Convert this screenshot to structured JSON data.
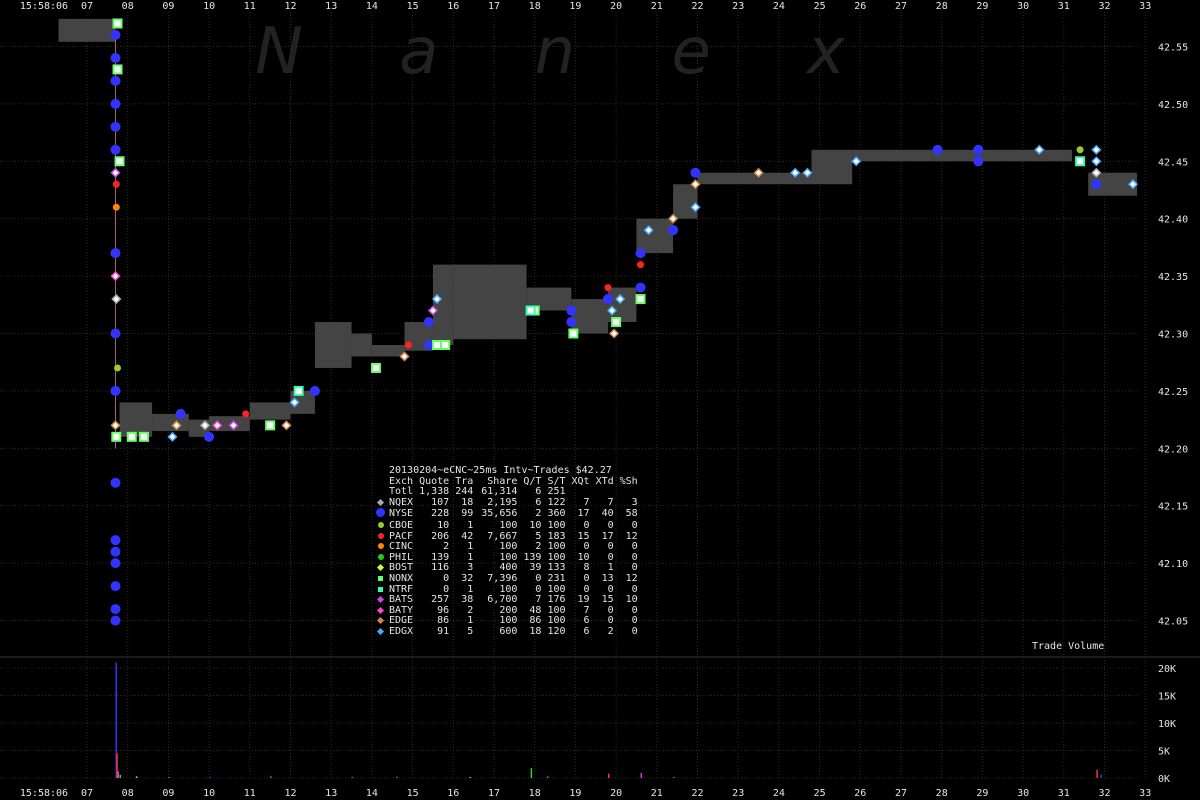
{
  "chart_data": [
    {
      "type": "scatter",
      "title": "20130204~eCNC~25ms Intv~Trades $42.27",
      "start_time_label": "15:58:06",
      "x_tick_labels": [
        "07",
        "08",
        "09",
        "10",
        "11",
        "12",
        "13",
        "14",
        "15",
        "16",
        "17",
        "18",
        "19",
        "20",
        "21",
        "22",
        "23",
        "24",
        "25",
        "26",
        "27",
        "28",
        "29",
        "30",
        "31",
        "32",
        "33"
      ],
      "xlim": [
        6.5,
        33.4
      ],
      "ylim": [
        42.02,
        42.58
      ],
      "y_tick_labels": [
        "42.55",
        "42.50",
        "42.45",
        "42.40",
        "42.35",
        "42.30",
        "42.25",
        "42.20",
        "42.15",
        "42.10",
        "42.05"
      ],
      "y_ticks": [
        42.55,
        42.5,
        42.45,
        42.4,
        42.35,
        42.3,
        42.25,
        42.2,
        42.15,
        42.1,
        42.05
      ],
      "quote_spread": [
        [
          6.3,
          7.7,
          42.554,
          42.574
        ],
        [
          7.8,
          8.6,
          42.21,
          42.24
        ],
        [
          8.6,
          9.5,
          42.215,
          42.23
        ],
        [
          9.5,
          10.0,
          42.21,
          42.225
        ],
        [
          10.0,
          11.0,
          42.215,
          42.228
        ],
        [
          11.0,
          12.0,
          42.225,
          42.24
        ],
        [
          12.0,
          12.6,
          42.23,
          42.25
        ],
        [
          12.6,
          13.5,
          42.27,
          42.31
        ],
        [
          13.5,
          14.0,
          42.28,
          42.3
        ],
        [
          14.0,
          14.8,
          42.28,
          42.29
        ],
        [
          14.8,
          15.5,
          42.285,
          42.31
        ],
        [
          15.5,
          16.0,
          42.29,
          42.36
        ],
        [
          16.0,
          17.8,
          42.295,
          42.36
        ],
        [
          17.8,
          18.9,
          42.32,
          42.34
        ],
        [
          18.9,
          19.8,
          42.3,
          42.33
        ],
        [
          19.8,
          20.5,
          42.31,
          42.34
        ],
        [
          20.5,
          21.4,
          42.37,
          42.4
        ],
        [
          21.4,
          22.0,
          42.4,
          42.43
        ],
        [
          22.0,
          24.8,
          42.43,
          42.44
        ],
        [
          24.8,
          25.8,
          42.43,
          42.46
        ],
        [
          25.8,
          31.2,
          42.45,
          42.46
        ],
        [
          31.6,
          32.8,
          42.42,
          42.44
        ]
      ],
      "trades": [
        {
          "x": 7.7,
          "y": 42.56,
          "ex": "NYSE"
        },
        {
          "x": 7.7,
          "y": 42.54,
          "ex": "NYSE"
        },
        {
          "x": 7.7,
          "y": 42.52,
          "ex": "NYSE"
        },
        {
          "x": 7.7,
          "y": 42.5,
          "ex": "NYSE"
        },
        {
          "x": 7.7,
          "y": 42.48,
          "ex": "NYSE"
        },
        {
          "x": 7.7,
          "y": 42.46,
          "ex": "NYSE"
        },
        {
          "x": 7.7,
          "y": 42.44,
          "ex": "BATS"
        },
        {
          "x": 7.72,
          "y": 42.43,
          "ex": "PACF"
        },
        {
          "x": 7.72,
          "y": 42.41,
          "ex": "CINC"
        },
        {
          "x": 7.7,
          "y": 42.37,
          "ex": "NYSE"
        },
        {
          "x": 7.7,
          "y": 42.35,
          "ex": "BATY"
        },
        {
          "x": 7.72,
          "y": 42.33,
          "ex": "NQEX"
        },
        {
          "x": 7.7,
          "y": 42.3,
          "ex": "NYSE"
        },
        {
          "x": 7.75,
          "y": 42.27,
          "ex": "CBOE"
        },
        {
          "x": 7.7,
          "y": 42.25,
          "ex": "NYSE"
        },
        {
          "x": 7.7,
          "y": 42.22,
          "ex": "EDGE"
        },
        {
          "x": 7.72,
          "y": 42.21,
          "ex": "NONX"
        },
        {
          "x": 7.7,
          "y": 42.17,
          "ex": "NYSE"
        },
        {
          "x": 7.7,
          "y": 42.12,
          "ex": "NYSE"
        },
        {
          "x": 7.7,
          "y": 42.11,
          "ex": "NYSE"
        },
        {
          "x": 7.7,
          "y": 42.1,
          "ex": "NYSE"
        },
        {
          "x": 7.7,
          "y": 42.08,
          "ex": "NYSE"
        },
        {
          "x": 7.7,
          "y": 42.06,
          "ex": "NYSE"
        },
        {
          "x": 7.7,
          "y": 42.05,
          "ex": "NYSE"
        },
        {
          "x": 7.75,
          "y": 42.57,
          "ex": "NONX"
        },
        {
          "x": 7.75,
          "y": 42.53,
          "ex": "NONX"
        },
        {
          "x": 7.8,
          "y": 42.45,
          "ex": "NONX"
        },
        {
          "x": 8.1,
          "y": 42.21,
          "ex": "NONX"
        },
        {
          "x": 8.4,
          "y": 42.21,
          "ex": "NONX"
        },
        {
          "x": 9.1,
          "y": 42.21,
          "ex": "EDGX"
        },
        {
          "x": 9.2,
          "y": 42.22,
          "ex": "EDGE"
        },
        {
          "x": 9.3,
          "y": 42.23,
          "ex": "NYSE"
        },
        {
          "x": 9.9,
          "y": 42.22,
          "ex": "NQEX"
        },
        {
          "x": 10.0,
          "y": 42.21,
          "ex": "NYSE"
        },
        {
          "x": 10.2,
          "y": 42.22,
          "ex": "BATY"
        },
        {
          "x": 10.6,
          "y": 42.22,
          "ex": "BATS"
        },
        {
          "x": 10.9,
          "y": 42.23,
          "ex": "PACF"
        },
        {
          "x": 11.5,
          "y": 42.22,
          "ex": "NONX"
        },
        {
          "x": 11.9,
          "y": 42.22,
          "ex": "EDGE"
        },
        {
          "x": 12.1,
          "y": 42.24,
          "ex": "EDGX"
        },
        {
          "x": 12.2,
          "y": 42.25,
          "ex": "NTRF"
        },
        {
          "x": 12.6,
          "y": 42.25,
          "ex": "NYSE"
        },
        {
          "x": 14.1,
          "y": 42.27,
          "ex": "NONX"
        },
        {
          "x": 14.8,
          "y": 42.28,
          "ex": "EDGE"
        },
        {
          "x": 14.9,
          "y": 42.29,
          "ex": "PACF"
        },
        {
          "x": 15.4,
          "y": 42.29,
          "ex": "NYSE"
        },
        {
          "x": 15.6,
          "y": 42.29,
          "ex": "NONX"
        },
        {
          "x": 15.8,
          "y": 42.29,
          "ex": "NONX"
        },
        {
          "x": 15.4,
          "y": 42.31,
          "ex": "NYSE"
        },
        {
          "x": 15.5,
          "y": 42.32,
          "ex": "BATS"
        },
        {
          "x": 15.6,
          "y": 42.33,
          "ex": "EDGX"
        },
        {
          "x": 18.0,
          "y": 42.32,
          "ex": "NONX"
        },
        {
          "x": 17.9,
          "y": 42.32,
          "ex": "NTRF"
        },
        {
          "x": 18.9,
          "y": 42.32,
          "ex": "NYSE"
        },
        {
          "x": 18.9,
          "y": 42.31,
          "ex": "NYSE"
        },
        {
          "x": 18.95,
          "y": 42.3,
          "ex": "NONX"
        },
        {
          "x": 19.8,
          "y": 42.34,
          "ex": "PACF"
        },
        {
          "x": 19.8,
          "y": 42.33,
          "ex": "NYSE"
        },
        {
          "x": 19.9,
          "y": 42.32,
          "ex": "EDGX"
        },
        {
          "x": 19.95,
          "y": 42.3,
          "ex": "EDGE"
        },
        {
          "x": 20.0,
          "y": 42.31,
          "ex": "NONX"
        },
        {
          "x": 20.1,
          "y": 42.33,
          "ex": "EDGX"
        },
        {
          "x": 20.6,
          "y": 42.37,
          "ex": "NYSE"
        },
        {
          "x": 20.6,
          "y": 42.36,
          "ex": "PACF"
        },
        {
          "x": 20.6,
          "y": 42.34,
          "ex": "NYSE"
        },
        {
          "x": 20.6,
          "y": 42.33,
          "ex": "NONX"
        },
        {
          "x": 20.8,
          "y": 42.39,
          "ex": "EDGX"
        },
        {
          "x": 21.4,
          "y": 42.4,
          "ex": "EDGE"
        },
        {
          "x": 21.4,
          "y": 42.39,
          "ex": "NYSE"
        },
        {
          "x": 21.95,
          "y": 42.44,
          "ex": "NYSE"
        },
        {
          "x": 21.95,
          "y": 42.43,
          "ex": "EDGE"
        },
        {
          "x": 21.95,
          "y": 42.41,
          "ex": "EDGX"
        },
        {
          "x": 23.5,
          "y": 42.44,
          "ex": "EDGE"
        },
        {
          "x": 24.4,
          "y": 42.44,
          "ex": "EDGX"
        },
        {
          "x": 24.7,
          "y": 42.44,
          "ex": "EDGX"
        },
        {
          "x": 25.9,
          "y": 42.45,
          "ex": "EDGX"
        },
        {
          "x": 27.9,
          "y": 42.46,
          "ex": "NYSE"
        },
        {
          "x": 28.9,
          "y": 42.46,
          "ex": "NYSE"
        },
        {
          "x": 28.9,
          "y": 42.45,
          "ex": "NYSE"
        },
        {
          "x": 30.4,
          "y": 42.46,
          "ex": "EDGX"
        },
        {
          "x": 31.4,
          "y": 42.46,
          "ex": "CBOE"
        },
        {
          "x": 31.4,
          "y": 42.45,
          "ex": "NTRF"
        },
        {
          "x": 31.8,
          "y": 42.46,
          "ex": "EDGX"
        },
        {
          "x": 31.8,
          "y": 42.45,
          "ex": "EDGX"
        },
        {
          "x": 31.8,
          "y": 42.44,
          "ex": "NQEX"
        },
        {
          "x": 31.8,
          "y": 42.43,
          "ex": "NYSE"
        },
        {
          "x": 32.7,
          "y": 42.43,
          "ex": "EDGX"
        }
      ],
      "watermark_letters": [
        "N",
        "a",
        "n",
        "e",
        "x"
      ]
    },
    {
      "type": "bar",
      "title": "Trade Volume",
      "y_tick_labels": [
        "20K",
        "15K",
        "10K",
        "5K",
        "0K"
      ],
      "y_ticks": [
        20000,
        15000,
        10000,
        5000,
        0
      ],
      "ylim": [
        0,
        22000
      ],
      "bars": [
        {
          "x": 7.7,
          "v": 21000,
          "c": "#3333ff"
        },
        {
          "x": 7.72,
          "v": 4500,
          "c": "#ff3333"
        },
        {
          "x": 7.75,
          "v": 1200,
          "c": "#cc44cc"
        },
        {
          "x": 7.8,
          "v": 600,
          "c": "#33cc33"
        },
        {
          "x": 8.2,
          "v": 300,
          "c": "#66ff66"
        },
        {
          "x": 9.0,
          "v": 200,
          "c": "#cc44cc"
        },
        {
          "x": 10.0,
          "v": 250,
          "c": "#3333ff"
        },
        {
          "x": 11.5,
          "v": 300,
          "c": "#cc44cc"
        },
        {
          "x": 13.5,
          "v": 200,
          "c": "#cc44cc"
        },
        {
          "x": 14.6,
          "v": 250,
          "c": "#ff3333"
        },
        {
          "x": 16.4,
          "v": 200,
          "c": "#66ff66"
        },
        {
          "x": 17.9,
          "v": 1800,
          "c": "#33cc33"
        },
        {
          "x": 18.3,
          "v": 300,
          "c": "#cc44cc"
        },
        {
          "x": 19.8,
          "v": 800,
          "c": "#ff3333"
        },
        {
          "x": 20.6,
          "v": 900,
          "c": "#cc44cc"
        },
        {
          "x": 21.4,
          "v": 200,
          "c": "#cc44cc"
        },
        {
          "x": 31.8,
          "v": 1500,
          "c": "#ff3333"
        },
        {
          "x": 31.9,
          "v": 600,
          "c": "#3333ff"
        }
      ]
    }
  ],
  "legend": {
    "headers": [
      "Exch",
      "Quote",
      "Tra",
      "Share",
      "Q/T",
      "S/T",
      "XQt",
      "XTd",
      "%Sh"
    ],
    "total": [
      "Totl",
      "1,338",
      "244",
      "61,314",
      "6",
      "251",
      "",
      "",
      ""
    ],
    "rows": [
      {
        "ex": "NQEX",
        "c": [
          "107",
          "18",
          "2,195",
          "6",
          "122",
          "7",
          "7",
          "3"
        ],
        "color": "#aaaaaa",
        "shape": "diamond"
      },
      {
        "ex": "NYSE",
        "c": [
          "228",
          "99",
          "35,656",
          "2",
          "360",
          "17",
          "40",
          "58"
        ],
        "color": "#3333ff",
        "shape": "circle"
      },
      {
        "ex": "CBOE",
        "c": [
          "10",
          "1",
          "100",
          "10",
          "100",
          "0",
          "0",
          "0"
        ],
        "color": "#99cc33",
        "shape": "circle"
      },
      {
        "ex": "PACF",
        "c": [
          "206",
          "42",
          "7,667",
          "5",
          "183",
          "15",
          "17",
          "12"
        ],
        "color": "#ff2222",
        "shape": "circle"
      },
      {
        "ex": "CINC",
        "c": [
          "2",
          "1",
          "100",
          "2",
          "100",
          "0",
          "0",
          "0"
        ],
        "color": "#ff8800",
        "shape": "circle"
      },
      {
        "ex": "PHIL",
        "c": [
          "139",
          "1",
          "100",
          "139",
          "100",
          "10",
          "0",
          "0"
        ],
        "color": "#22cc22",
        "shape": "circle"
      },
      {
        "ex": "BOST",
        "c": [
          "116",
          "3",
          "400",
          "39",
          "133",
          "8",
          "1",
          "0"
        ],
        "color": "#ccff33",
        "shape": "diamond"
      },
      {
        "ex": "NONX",
        "c": [
          "0",
          "32",
          "7,396",
          "0",
          "231",
          "0",
          "13",
          "12"
        ],
        "color": "#66ff66",
        "shape": "square"
      },
      {
        "ex": "NTRF",
        "c": [
          "0",
          "1",
          "100",
          "0",
          "100",
          "0",
          "0",
          "0"
        ],
        "color": "#33ffaa",
        "shape": "square"
      },
      {
        "ex": "BATS",
        "c": [
          "257",
          "38",
          "6,700",
          "7",
          "176",
          "19",
          "15",
          "10"
        ],
        "color": "#cc44ee",
        "shape": "diamond"
      },
      {
        "ex": "BATY",
        "c": [
          "96",
          "2",
          "200",
          "48",
          "100",
          "7",
          "0",
          "0"
        ],
        "color": "#ff44cc",
        "shape": "diamond"
      },
      {
        "ex": "EDGE",
        "c": [
          "86",
          "1",
          "100",
          "86",
          "100",
          "6",
          "0",
          "0"
        ],
        "color": "#cc8844",
        "shape": "diamond"
      },
      {
        "ex": "EDGX",
        "c": [
          "91",
          "5",
          "600",
          "18",
          "120",
          "6",
          "2",
          "0"
        ],
        "color": "#44aaff",
        "shape": "diamond"
      }
    ]
  }
}
